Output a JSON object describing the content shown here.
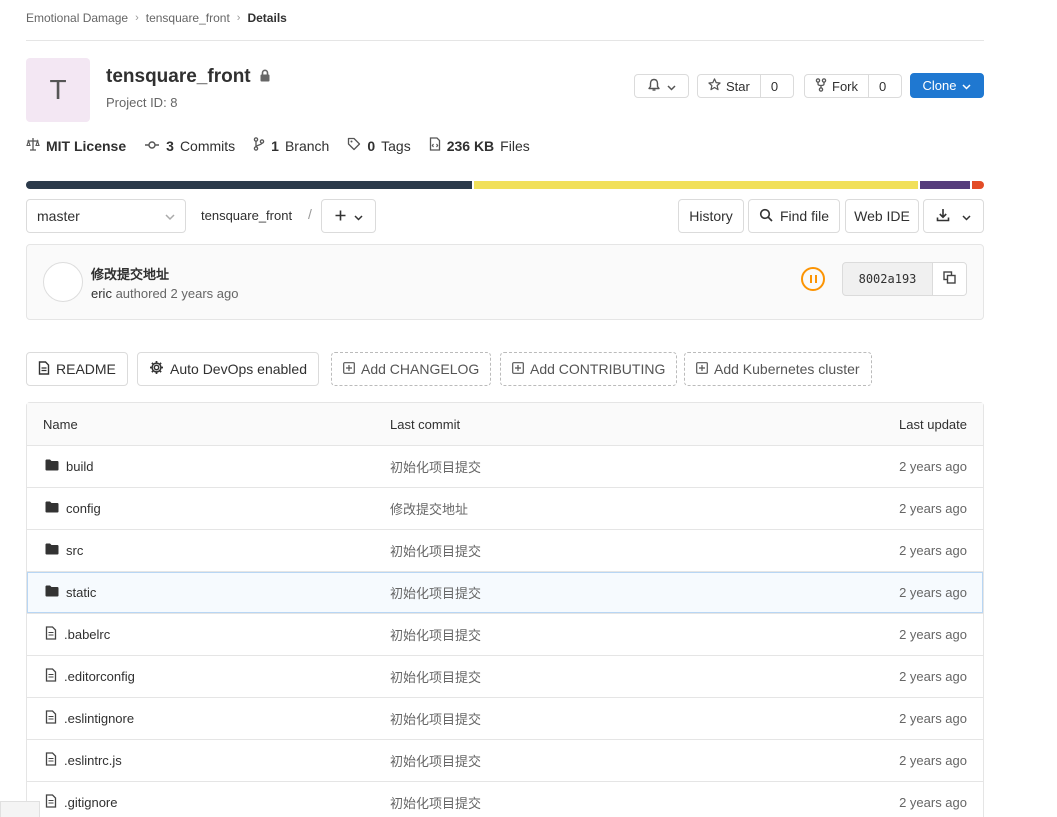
{
  "breadcrumb": {
    "group": "Emotional Damage",
    "project": "tensquare_front",
    "current": "Details"
  },
  "project": {
    "avatar_letter": "T",
    "name": "tensquare_front",
    "id_label": "Project ID: 8"
  },
  "actions": {
    "star_label": "Star",
    "star_count": "0",
    "fork_label": "Fork",
    "fork_count": "0",
    "clone_label": "Clone"
  },
  "stats": {
    "license": "MIT License",
    "commits_count": "3",
    "commits_label": "Commits",
    "branch_count": "1",
    "branch_label": "Branch",
    "tags_count": "0",
    "tags_label": "Tags",
    "files_size": "236 KB",
    "files_label": "Files"
  },
  "languages": [
    {
      "color": "#2b3a4a",
      "share": 0.468
    },
    {
      "color": "#f1e05a",
      "share": 0.467
    },
    {
      "color": "#563d7c",
      "share": 0.052
    },
    {
      "color": "#e34c26",
      "share": 0.013
    }
  ],
  "repo_nav": {
    "branch": "master",
    "path": "tensquare_front",
    "path_sep": "/",
    "history": "History",
    "find_file": "Find file",
    "web_ide": "Web IDE"
  },
  "last_commit": {
    "title": "修改提交地址",
    "author": "eric",
    "authored": "authored",
    "time": "2 years ago",
    "sha": "8002a193"
  },
  "quick_links": {
    "readme": "README",
    "auto_devops": "Auto DevOps enabled",
    "changelog": "Add CHANGELOG",
    "contributing": "Add CONTRIBUTING",
    "kubernetes": "Add Kubernetes cluster"
  },
  "table": {
    "headers": {
      "name": "Name",
      "commit": "Last commit",
      "update": "Last update"
    },
    "rows": [
      {
        "type": "folder",
        "name": "build",
        "commit": "初始化项目提交",
        "update": "2 years ago"
      },
      {
        "type": "folder",
        "name": "config",
        "commit": "修改提交地址",
        "update": "2 years ago"
      },
      {
        "type": "folder",
        "name": "src",
        "commit": "初始化项目提交",
        "update": "2 years ago"
      },
      {
        "type": "folder",
        "name": "static",
        "commit": "初始化项目提交",
        "update": "2 years ago"
      },
      {
        "type": "file",
        "name": ".babelrc",
        "commit": "初始化项目提交",
        "update": "2 years ago"
      },
      {
        "type": "file",
        "name": ".editorconfig",
        "commit": "初始化项目提交",
        "update": "2 years ago"
      },
      {
        "type": "file",
        "name": ".eslintignore",
        "commit": "初始化项目提交",
        "update": "2 years ago"
      },
      {
        "type": "file",
        "name": ".eslintrc.js",
        "commit": "初始化项目提交",
        "update": "2 years ago"
      },
      {
        "type": "file",
        "name": ".gitignore",
        "commit": "初始化项目提交",
        "update": "2 years ago"
      }
    ]
  }
}
